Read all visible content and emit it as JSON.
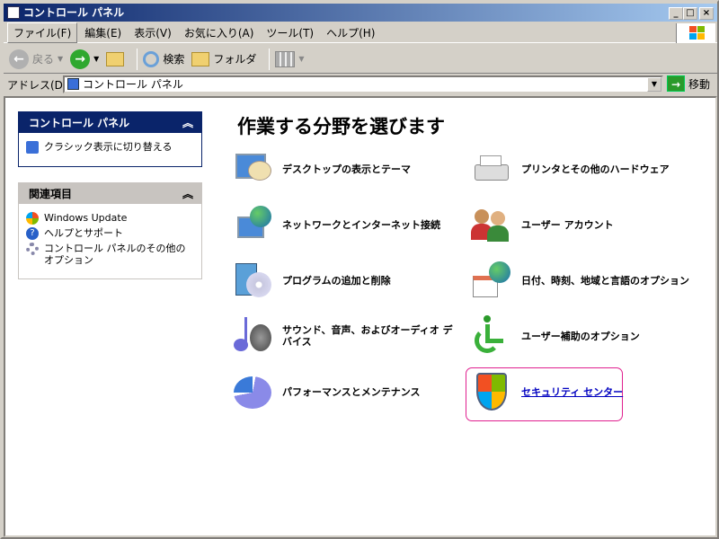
{
  "window": {
    "title": "コントロール パネル",
    "minimize": "_",
    "maximize": "□",
    "close": "×"
  },
  "menu": [
    "ファイル(F)",
    "編集(E)",
    "表示(V)",
    "お気に入り(A)",
    "ツール(T)",
    "ヘルプ(H)"
  ],
  "toolbar": {
    "back": "戻る",
    "search": "検索",
    "folders": "フォルダ"
  },
  "address": {
    "label": "アドレス(D)",
    "value": "コントロール パネル",
    "go": "移動"
  },
  "sidebar": {
    "control_panel": {
      "title": "コントロール パネル",
      "items": [
        "クラシック表示に切り替える"
      ]
    },
    "related": {
      "title": "関連項目",
      "items": [
        "Windows Update",
        "ヘルプとサポート",
        "コントロール パネルのその他のオプション"
      ]
    }
  },
  "main": {
    "heading": "作業する分野を選びます",
    "categories": [
      "デスクトップの表示とテーマ",
      "プリンタとその他のハードウェア",
      "ネットワークとインターネット接続",
      "ユーザー アカウント",
      "プログラムの追加と削除",
      "日付、時刻、地域と言語のオプション",
      "サウンド、音声、およびオーディオ デバイス",
      "ユーザー補助のオプション",
      "パフォーマンスとメンテナンス",
      "セキュリティ センター"
    ]
  }
}
